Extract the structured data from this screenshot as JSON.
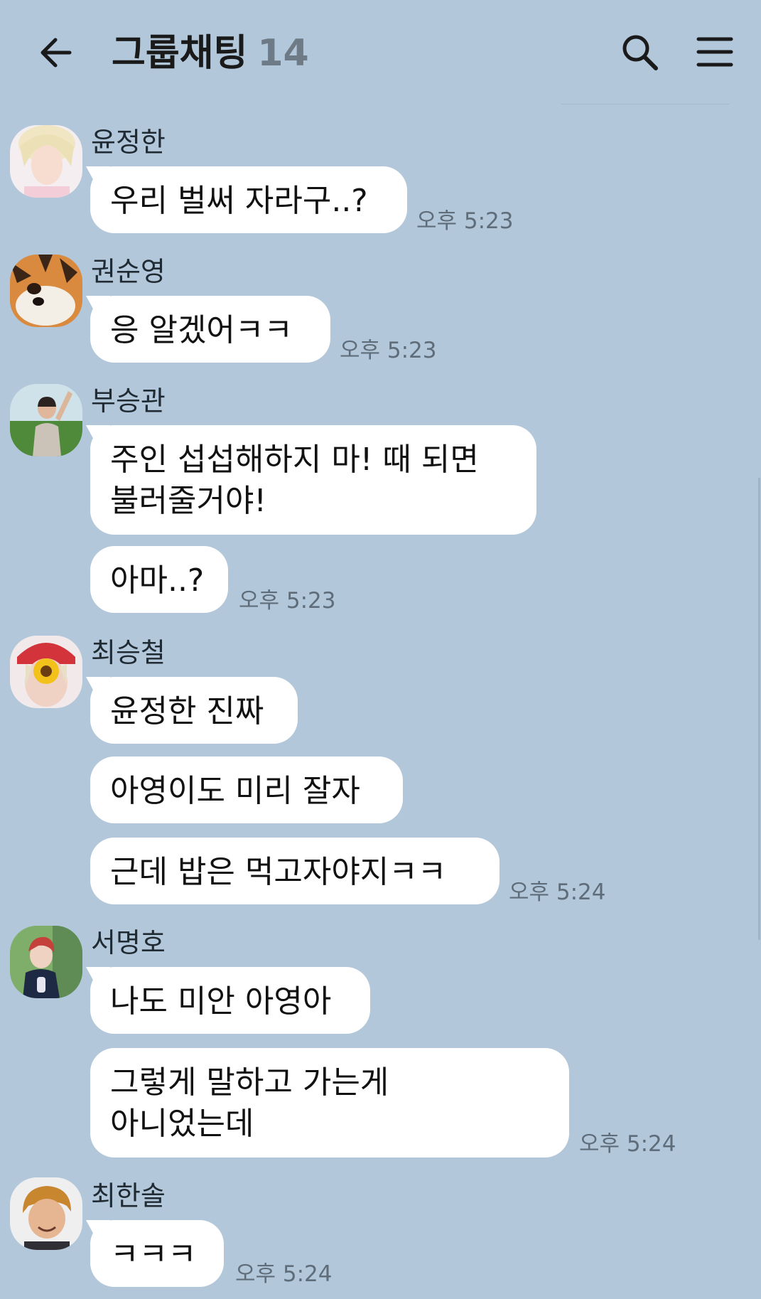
{
  "header": {
    "title": "그룹채팅",
    "member_count": "14"
  },
  "messages": [
    {
      "sender": "윤정한",
      "bubbles": [
        "우리 벌써 자라구..?"
      ],
      "time": "오후 5:23"
    },
    {
      "sender": "권순영",
      "bubbles": [
        "응 알겠어ㅋㅋ"
      ],
      "time": "오후 5:23"
    },
    {
      "sender": "부승관",
      "bubbles": [
        "주인 섭섭해하지 마! 때 되면\n불러줄거야!",
        "아마..?"
      ],
      "time": "오후 5:23"
    },
    {
      "sender": "최승철",
      "bubbles": [
        "윤정한 진짜",
        "아영이도 미리 잘자",
        "근데 밥은 먹고자야지ㅋㅋ"
      ],
      "time": "오후 5:24"
    },
    {
      "sender": "서명호",
      "bubbles": [
        "나도 미안 아영아",
        "그렇게 말하고 가는게\n아니었는데"
      ],
      "time": "오후 5:24"
    },
    {
      "sender": "최한솔",
      "bubbles": [
        "ㅋㅋㅋ"
      ],
      "time": "오후 5:24"
    }
  ],
  "colors": {
    "background": "#b2c7da",
    "bubble": "#ffffff",
    "text": "#111111",
    "time": "#5f6d7a"
  },
  "icons": {
    "back": "arrow-left-icon",
    "search": "search-icon",
    "menu": "hamburger-menu-icon"
  }
}
